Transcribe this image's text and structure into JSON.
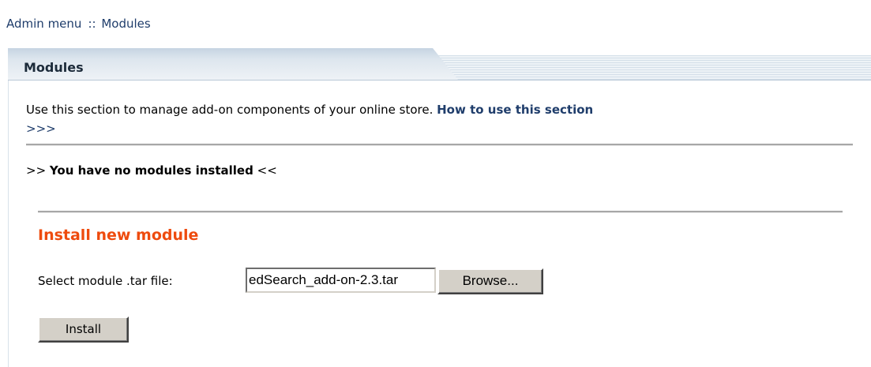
{
  "breadcrumb": {
    "root": "Admin menu",
    "separator": "::",
    "current": "Modules"
  },
  "panel": {
    "title": "Modules"
  },
  "intro": {
    "text": "Use this section to manage add-on components of your online store.",
    "help_link": "How to use this section",
    "more_link": ">>>"
  },
  "status": {
    "prefix": ">>",
    "message": "You have no modules installed",
    "suffix": "<<"
  },
  "install": {
    "heading": "Install new module",
    "file_label": "Select module .tar file:",
    "file_value": "edSearch_add-on-2.3.tar",
    "browse_label": "Browse...",
    "install_label": "Install"
  },
  "colors": {
    "link": "#1f3d6b",
    "heading_accent": "#ee4b0e",
    "button_face": "#d4d0c8",
    "tab_gradient_top": "#c6d4e2"
  }
}
